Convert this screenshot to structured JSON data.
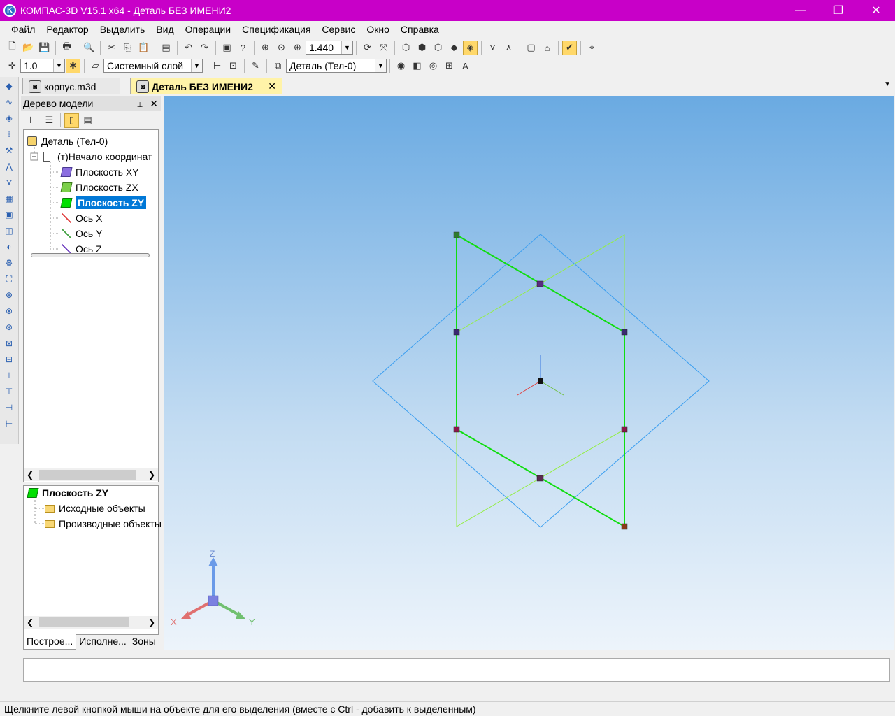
{
  "window": {
    "title": "КОМПАС-3D V15.1 x64 - Деталь БЕЗ ИМЕНИ2",
    "app_icon": "kompas-logo-icon",
    "min": "—",
    "max": "❐",
    "close": "✕"
  },
  "menu": [
    "Файл",
    "Редактор",
    "Выделить",
    "Вид",
    "Операции",
    "Спецификация",
    "Сервис",
    "Окно",
    "Справка"
  ],
  "toolbar1": {
    "zoom_value": "1.440"
  },
  "toolbar2": {
    "step_value": "1.0",
    "layer_value": "Системный слой",
    "body_value": "Деталь (Тел-0)"
  },
  "tabs": [
    {
      "label": "корпус.m3d",
      "icon": "part-file-icon"
    },
    {
      "label": "Деталь БЕЗ ИМЕНИ2",
      "icon": "part-file-icon",
      "close": "✕"
    }
  ],
  "model_tree": {
    "title": "Дерево модели",
    "pin": "📌",
    "close": "✕",
    "items": [
      {
        "label": "Деталь (Тел-0)",
        "icon": "part-icon"
      },
      {
        "label": "(т)Начало координат",
        "icon": "origin-icon"
      },
      {
        "label": "Плоскость XY",
        "icon": "plane-xy-icon"
      },
      {
        "label": "Плоскость ZX",
        "icon": "plane-zx-icon"
      },
      {
        "label": "Плоскость ZY",
        "icon": "plane-zy-icon"
      },
      {
        "label": "Ось X",
        "icon": "axis-x-icon"
      },
      {
        "label": "Ось Y",
        "icon": "axis-y-icon"
      },
      {
        "label": "Ось Z",
        "icon": "axis-z-icon"
      }
    ],
    "selected_index": 4
  },
  "relations_tree": {
    "items": [
      {
        "label": "Плоскость ZY",
        "icon": "plane-zy-icon"
      },
      {
        "label": "Исходные объекты",
        "icon": "folder-icon"
      },
      {
        "label": "Производные объекты",
        "icon": "folder-icon"
      }
    ]
  },
  "panel_tabs": [
    "Построе...",
    "Исполне...",
    "Зоны"
  ],
  "triad": {
    "x": "X",
    "y": "Y",
    "z": "Z"
  },
  "colors": {
    "title_bar": "#c800c8",
    "zy_plane": "#00e000",
    "zx_plane": "#90ee40",
    "xy_plane": "#3fa0f0",
    "selection": "#0078d7"
  },
  "status": "Щелкните левой кнопкой мыши на объекте для его выделения (вместе с Ctrl - добавить к выделенным)"
}
